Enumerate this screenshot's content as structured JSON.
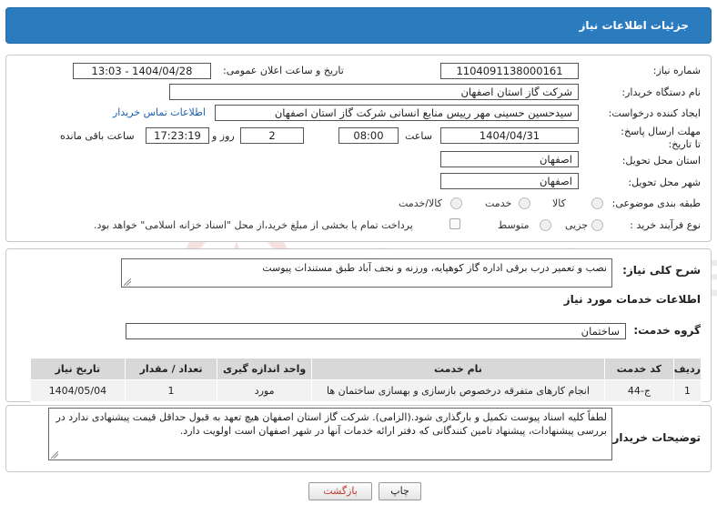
{
  "header": {
    "title": "جزئیات اطلاعات نیاز"
  },
  "fields": {
    "need_number_label": "شماره نیاز:",
    "need_number": "1104091138000161",
    "announce_label": "تاریخ و ساعت اعلان عمومی:",
    "announce_value": "1404/04/28 - 13:03",
    "buyer_org_label": "نام دستگاه خریدار:",
    "buyer_org": "شرکت گاز استان اصفهان",
    "requester_label": "ایجاد کننده درخواست:",
    "requester": "سیدحسین حسینی مهر رییس منابع انسانی شرکت گاز استان اصفهان",
    "contact_link": "اطلاعات تماس خریدار",
    "deadline_label": "مهلت ارسال پاسخ: تا تاریخ:",
    "deadline_date": "1404/04/31",
    "time_label": "ساعت",
    "deadline_time": "08:00",
    "days_value": "2",
    "days_label": "روز و",
    "remaining_time": "17:23:19",
    "remaining_label": "ساعت باقی مانده",
    "province_label": "استان محل تحویل:",
    "province": "اصفهان",
    "city_label": "شهر محل تحویل:",
    "city": "اصفهان",
    "category_label": "طبقه بندی موضوعی:",
    "category_options": [
      "کالا",
      "خدمت",
      "کالا/خدمت"
    ],
    "process_label": "نوع فرآیند خرید :",
    "process_options": [
      "جزیی",
      "متوسط"
    ],
    "payment_note": "پرداخت تمام یا بخشی از مبلغ خرید،از محل \"اسناد خزانه اسلامی\" خواهد بود."
  },
  "summary": {
    "label": "شرح کلی نیاز:",
    "text": "نصب و تعمیر درب برقی اداره گاز کوهپایه، ورزنه و نجف آباد طبق مستندات پیوست"
  },
  "services": {
    "section_title": "اطلاعات خدمات مورد نیاز",
    "group_label": "گروه خدمت:",
    "group_value": "ساختمان",
    "columns": [
      "ردیف",
      "کد خدمت",
      "نام خدمت",
      "واحد اندازه گیری",
      "تعداد / مقدار",
      "تاریخ نیاز"
    ],
    "rows": [
      [
        "1",
        "ج-44",
        "انجام کارهای متفرقه درخصوص بازسازی و بهسازی ساختمان ها",
        "مورد",
        "1",
        "1404/05/04"
      ]
    ]
  },
  "buyer_notes": {
    "label": "توضیحات خریدار:",
    "text": "لطفاً کلیه اسناد پیوست تکمیل و بارگذاری شود.(الزامی). شرکت گاز  استان اصفهان هیچ تعهد به قبول حداقل قیمت پیشنهادی ندارد  در بررسی پیشنهادات، پیشنهاد تامین کنندگانی که دفتر ارائه خدمات آنها در شهر اصفهان است اولویت دارد."
  },
  "buttons": {
    "print": "چاپ",
    "back": "بازگشت"
  },
  "watermark": {
    "text": "AriaTender.neT"
  },
  "colors": {
    "title_bar": "#2a7cbf",
    "link": "#1a5fb4",
    "table_header": "#d8d8d8"
  }
}
